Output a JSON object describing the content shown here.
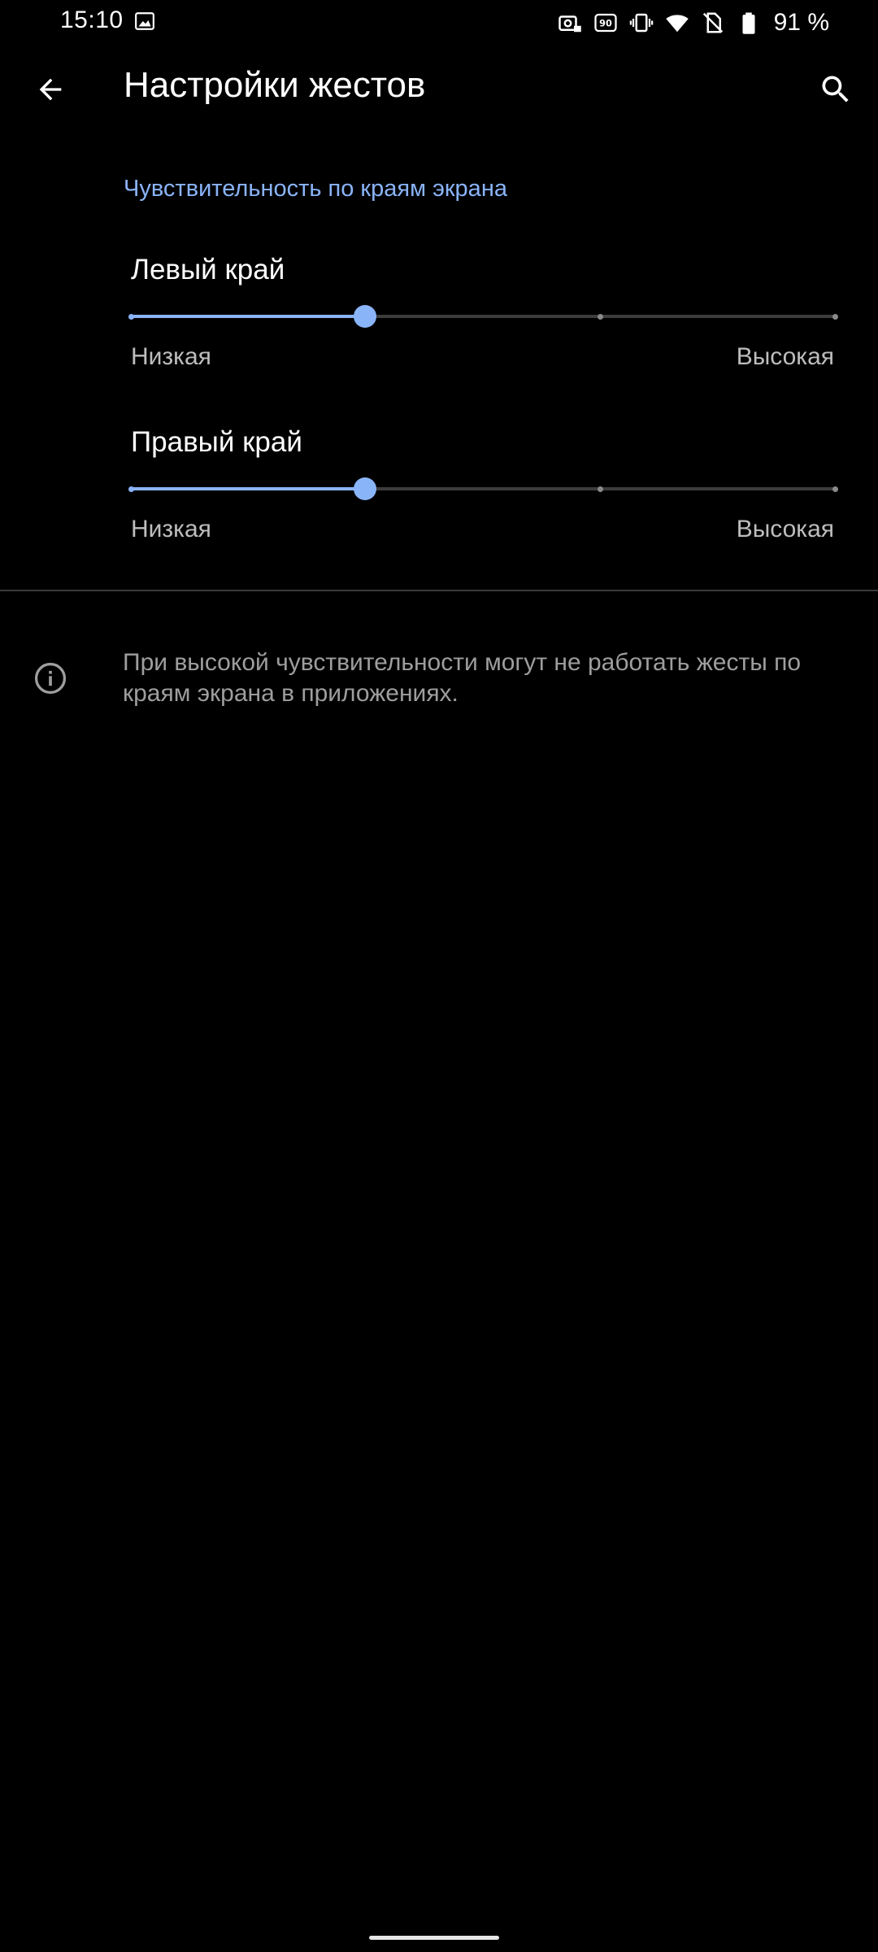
{
  "status_bar": {
    "time": "15:10",
    "battery_text": "91 %",
    "icons": [
      "image-icon",
      "camera-lock-icon",
      "refresh-rate-90-icon",
      "vibrate-icon",
      "wifi-icon",
      "no-sim-icon",
      "battery-icon"
    ]
  },
  "app_bar": {
    "title": "Настройки жестов",
    "back_icon": "arrow-back-icon",
    "search_icon": "search-icon"
  },
  "category": {
    "title": "Чувствительность по краям экрана"
  },
  "sliders": [
    {
      "title": "Левый край",
      "low_label": "Низкая",
      "high_label": "Высокая",
      "value_fraction": 0.333,
      "steps": 4
    },
    {
      "title": "Правый край",
      "low_label": "Низкая",
      "high_label": "Высокая",
      "value_fraction": 0.333,
      "steps": 4
    }
  ],
  "footer": {
    "info_icon": "info-icon",
    "text": "При высокой чувствительности могут не работать жесты по краям экрана в приложениях."
  },
  "colors": {
    "accent": "#8ab4f8",
    "background": "#000000",
    "secondary_text": "#9e9e9e"
  }
}
